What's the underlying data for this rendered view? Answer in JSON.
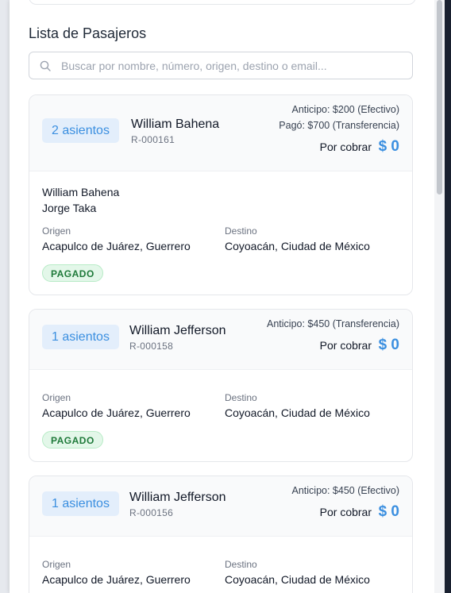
{
  "section": {
    "title": "Lista de Pasajeros"
  },
  "search": {
    "placeholder": "Buscar por nombre, número, origen, destino o email..."
  },
  "labels": {
    "por_cobrar": "Por cobrar",
    "origen": "Origen",
    "destino": "Destino"
  },
  "reservations": [
    {
      "seats": "2 asientos",
      "name": "William Bahena",
      "code": "R-000161",
      "payments": [
        "Anticipo: $200 (Efectivo)",
        "Pagó: $700 (Transferencia)"
      ],
      "por_cobrar": "$ 0",
      "travelers": [
        "William Bahena",
        "Jorge Taka"
      ],
      "origin": "Acapulco de Juárez, Guerrero",
      "destination": "Coyoacán, Ciudad de México",
      "status": "PAGADO"
    },
    {
      "seats": "1 asientos",
      "name": "William Jefferson",
      "code": "R-000158",
      "payments": [
        "Anticipo: $450 (Transferencia)"
      ],
      "por_cobrar": "$ 0",
      "travelers": [],
      "origin": "Acapulco de Juárez, Guerrero",
      "destination": "Coyoacán, Ciudad de México",
      "status": "PAGADO"
    },
    {
      "seats": "1 asientos",
      "name": "William Jefferson",
      "code": "R-000156",
      "payments": [
        "Anticipo: $450 (Efectivo)"
      ],
      "por_cobrar": "$ 0",
      "travelers": [],
      "origin": "Acapulco de Juárez, Guerrero",
      "destination": "Coyoacán, Ciudad de México",
      "status": ""
    }
  ],
  "colors": {
    "accent": "#3b8fe0",
    "paid_badge_bg": "#e3f7e9",
    "paid_badge_text": "#1f7a3a",
    "seat_badge_bg": "#e3eefb"
  },
  "icons": {
    "search": "search-icon"
  }
}
